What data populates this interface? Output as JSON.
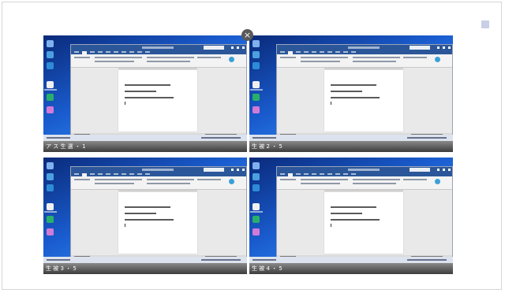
{
  "close_glyph": "×",
  "accent": "#2b579a",
  "thumbnails": [
    {
      "caption": "ア ス 生 選 ・ 1"
    },
    {
      "caption": "生 被 2 ・ 5"
    },
    {
      "caption": "生 被 3 ・ 5"
    },
    {
      "caption": "生 被 4 ・ 5"
    }
  ]
}
